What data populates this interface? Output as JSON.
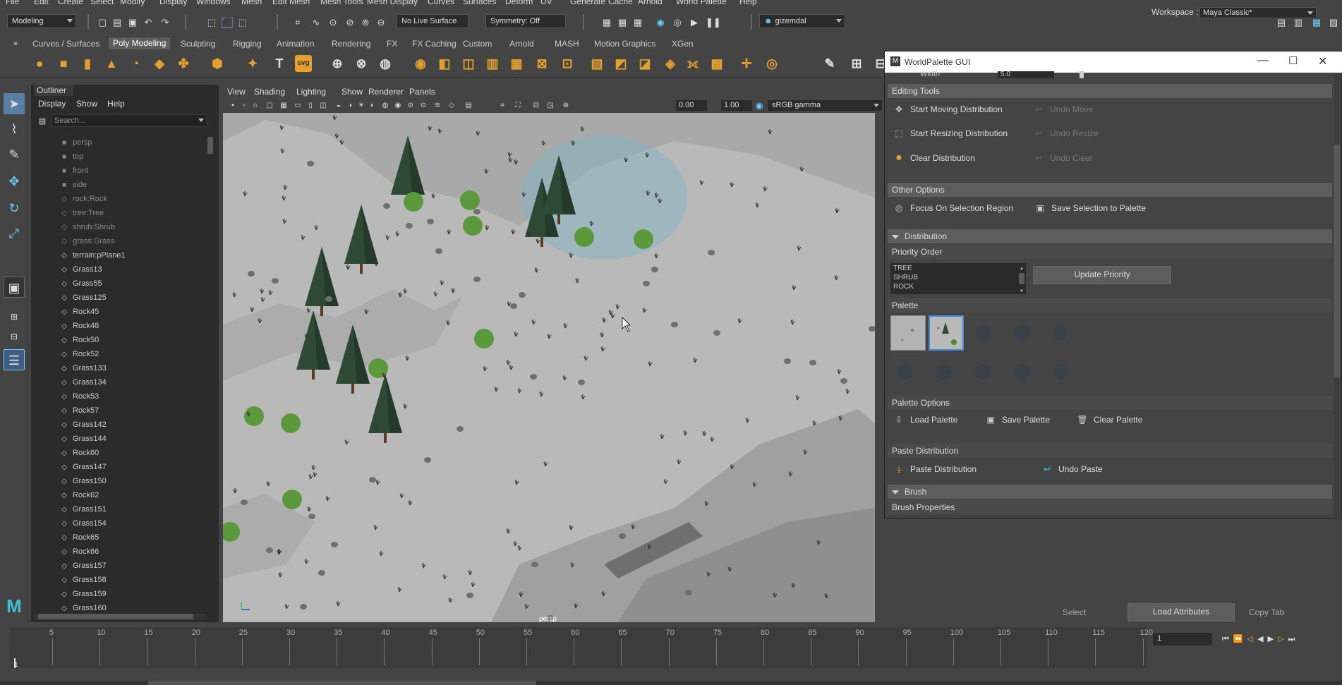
{
  "menubar": [
    "File",
    "Edit",
    "Create",
    "Select",
    "Modify",
    "Display",
    "Windows",
    "Mesh",
    "Edit Mesh",
    "Mesh Tools",
    "Mesh Display",
    "Curves",
    "Surfaces",
    "Deform",
    "UV",
    "Generate",
    "Cache",
    "Arnold",
    "World Palette",
    "Help"
  ],
  "workspace": {
    "label": "Workspace :",
    "value": "Maya Classic*"
  },
  "status": {
    "mode": "Modeling",
    "live_surface": "No Live Surface",
    "symmetry": "Symmetry: Off",
    "user": "gizemdal"
  },
  "shelf_tabs": [
    "Curves / Surfaces",
    "Poly Modeling",
    "Sculpting",
    "Rigging",
    "Animation",
    "Rendering",
    "FX",
    "FX Caching",
    "Custom",
    "Arnold",
    "MASH",
    "Motion Graphics",
    "XGen"
  ],
  "shelf_active": "Poly Modeling",
  "outliner": {
    "title": "Outliner",
    "menu": [
      "Display",
      "Show",
      "Help"
    ],
    "search_placeholder": "Search...",
    "items": [
      {
        "label": "persp",
        "kind": "camera",
        "dim": true
      },
      {
        "label": "top",
        "kind": "camera",
        "dim": true
      },
      {
        "label": "front",
        "kind": "camera",
        "dim": true
      },
      {
        "label": "side",
        "kind": "camera",
        "dim": true
      },
      {
        "label": "rock:Rock",
        "kind": "mesh",
        "dim": true
      },
      {
        "label": "tree:Tree",
        "kind": "mesh",
        "dim": true
      },
      {
        "label": "shrub:Shrub",
        "kind": "mesh",
        "dim": true
      },
      {
        "label": "grass:Grass",
        "kind": "mesh",
        "dim": true
      },
      {
        "label": "terrain:pPlane1",
        "kind": "mesh",
        "dim": false
      },
      {
        "label": "Grass13",
        "kind": "mesh",
        "dim": false
      },
      {
        "label": "Grass55",
        "kind": "mesh",
        "dim": false
      },
      {
        "label": "Grass125",
        "kind": "mesh",
        "dim": false
      },
      {
        "label": "Rock45",
        "kind": "mesh",
        "dim": false
      },
      {
        "label": "Rock48",
        "kind": "mesh",
        "dim": false
      },
      {
        "label": "Rock50",
        "kind": "mesh",
        "dim": false
      },
      {
        "label": "Rock52",
        "kind": "mesh",
        "dim": false
      },
      {
        "label": "Grass133",
        "kind": "mesh",
        "dim": false
      },
      {
        "label": "Grass134",
        "kind": "mesh",
        "dim": false
      },
      {
        "label": "Rock53",
        "kind": "mesh",
        "dim": false
      },
      {
        "label": "Rock57",
        "kind": "mesh",
        "dim": false
      },
      {
        "label": "Grass142",
        "kind": "mesh",
        "dim": false
      },
      {
        "label": "Grass144",
        "kind": "mesh",
        "dim": false
      },
      {
        "label": "Rock60",
        "kind": "mesh",
        "dim": false
      },
      {
        "label": "Grass147",
        "kind": "mesh",
        "dim": false
      },
      {
        "label": "Grass150",
        "kind": "mesh",
        "dim": false
      },
      {
        "label": "Rock62",
        "kind": "mesh",
        "dim": false
      },
      {
        "label": "Grass151",
        "kind": "mesh",
        "dim": false
      },
      {
        "label": "Grass154",
        "kind": "mesh",
        "dim": false
      },
      {
        "label": "Rock65",
        "kind": "mesh",
        "dim": false
      },
      {
        "label": "Rock66",
        "kind": "mesh",
        "dim": false
      },
      {
        "label": "Grass157",
        "kind": "mesh",
        "dim": false
      },
      {
        "label": "Grass158",
        "kind": "mesh",
        "dim": false
      },
      {
        "label": "Grass159",
        "kind": "mesh",
        "dim": false
      },
      {
        "label": "Grass160",
        "kind": "mesh",
        "dim": false
      }
    ]
  },
  "viewport": {
    "menu": [
      "View",
      "Shading",
      "Lighting",
      "Show",
      "Renderer",
      "Panels"
    ],
    "exposure": "0.00",
    "gamma": "1.00",
    "colorspace": "sRGB gamma",
    "camera_label": "persp"
  },
  "worldpalette": {
    "title": "WorldPalette GUI",
    "width_label": "Width",
    "width_value": "5.0",
    "editing_tools": {
      "header": "Editing Tools",
      "start_move": "Start Moving Distribution",
      "undo_move": "Undo Move",
      "start_resize": "Start Resizing Distribution",
      "undo_resize": "Undo Resize",
      "clear": "Clear Distribution",
      "undo_clear": "Undo Clear"
    },
    "other_options": {
      "header": "Other Options",
      "focus": "Focus On Selection Region",
      "save_selection": "Save Selection to Palette"
    },
    "distribution_header": "Distribution",
    "priority": {
      "header": "Priority Order",
      "items": [
        "TREE",
        "SHRUB",
        "ROCK"
      ],
      "update": "Update Priority"
    },
    "palette_header": "Palette",
    "palette_options": {
      "header": "Palette Options",
      "load": "Load Palette",
      "save": "Save Palette",
      "clear": "Clear Palette"
    },
    "paste": {
      "header": "Paste Distribution",
      "paste": "Paste Distribution",
      "undo": "Undo Paste"
    },
    "brush_header": "Brush",
    "brush_props": "Brush Properties"
  },
  "attribute_panel": {
    "select": "Select",
    "load": "Load Attributes",
    "copy": "Copy Tab"
  },
  "timeline": {
    "ticks": [
      "5",
      "10",
      "15",
      "20",
      "25",
      "30",
      "35",
      "40",
      "45",
      "50",
      "55",
      "60",
      "65",
      "70",
      "75",
      "80",
      "85",
      "90",
      "95",
      "100",
      "105",
      "110",
      "115",
      "120"
    ],
    "current": "1",
    "frame_field": "1"
  },
  "colors": {
    "accent": "#3e8ede",
    "shelf_orange": "#e59f2d",
    "viewport_bg": "#b9b9b9"
  }
}
